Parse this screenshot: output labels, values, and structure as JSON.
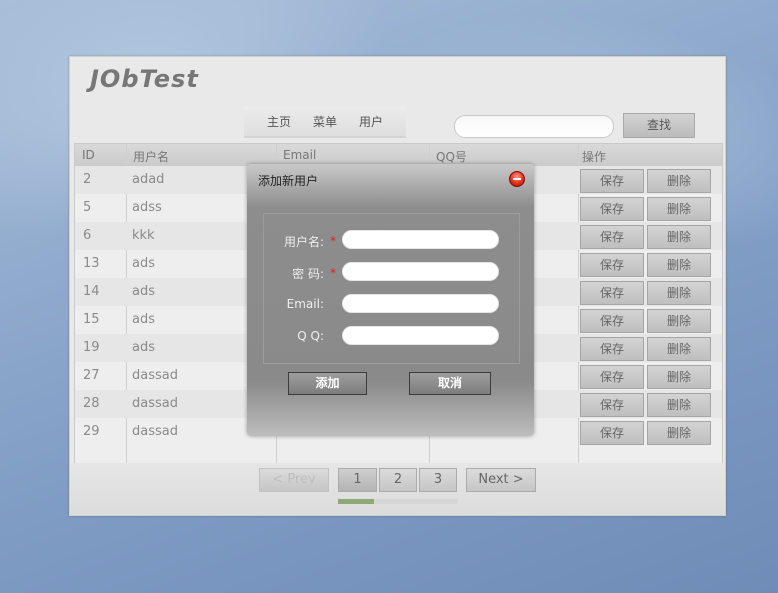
{
  "app": {
    "logo": "JObTest"
  },
  "nav": {
    "items": [
      "主页",
      "菜单",
      "用户"
    ]
  },
  "search": {
    "value": "",
    "button": "查找"
  },
  "grid": {
    "headers": {
      "id": "ID",
      "username": "用户名",
      "email": "Email",
      "qq": "QQ号",
      "actions": "操作"
    },
    "rows": [
      {
        "id": "2",
        "username": "adad"
      },
      {
        "id": "5",
        "username": "adss"
      },
      {
        "id": "6",
        "username": "kkk"
      },
      {
        "id": "13",
        "username": "ads"
      },
      {
        "id": "14",
        "username": "ads"
      },
      {
        "id": "15",
        "username": "ads"
      },
      {
        "id": "19",
        "username": "ads"
      },
      {
        "id": "27",
        "username": "dassad"
      },
      {
        "id": "28",
        "username": "dassad"
      },
      {
        "id": "29",
        "username": "dassad"
      }
    ],
    "save_label": "保存",
    "delete_label": "删除"
  },
  "pager": {
    "prev": "< Prev",
    "pages": [
      "1",
      "2",
      "3"
    ],
    "current": "1",
    "next": "Next >",
    "progress": 0.3
  },
  "dialog": {
    "title": "添加新用户",
    "required_mark": "*",
    "fields": {
      "username": "用户名:",
      "password": "密 码:",
      "email": "Email:",
      "qq": "Q Q:"
    },
    "add_button": "添加",
    "cancel_button": "取消"
  }
}
